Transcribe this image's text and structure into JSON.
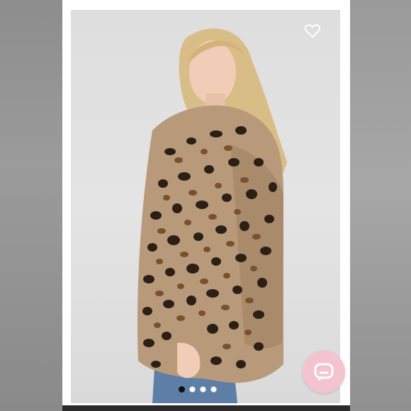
{
  "listing": {
    "image_alt": "",
    "like_icon": "heart-outline-icon",
    "chat_icon": "chat-bubble-icon",
    "carousel": {
      "count": 4,
      "active_index": 0
    }
  },
  "colors": {
    "chat_bubble_bg": "#f3c4cf",
    "photo_bg": "#e0e0e0",
    "coat_base": "#b89a7b",
    "spot_dark": "#2b2016",
    "spot_mid": "#7a5130"
  }
}
